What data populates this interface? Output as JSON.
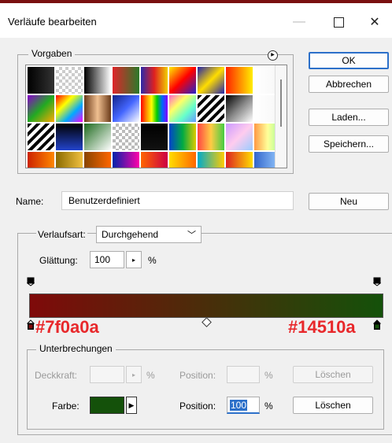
{
  "window": {
    "title": "Verläufe bearbeiten",
    "controls": {
      "minimize": "—",
      "close": "✕"
    }
  },
  "presets": {
    "label": "Vorgaben",
    "swatches": [
      "linear-gradient(90deg,#000,#333)",
      "repeating-conic-gradient(#ccc 0 25%,#fff 0 50%) 0 0/8px 8px",
      "linear-gradient(90deg,#000,#fff)",
      "linear-gradient(90deg,#e0252a,#2a7a2a)",
      "linear-gradient(90deg,#2a2aaa,#e02020,#f0d000)",
      "linear-gradient(135deg,#ffee00,#ff0000,#2222cc)",
      "linear-gradient(135deg,#2222aa,#ffdd00,#2222aa)",
      "linear-gradient(90deg,#ff2200,#ffee00)",
      "linear-gradient(90deg,#fff,#f6f6f6)",
      "linear-gradient(135deg,#8800cc,#22aa22,#ffaa00)",
      "linear-gradient(135deg,#ff0000,#ffff00,#00aaff,#ff00ff)",
      "linear-gradient(90deg,#6b3a1a,#f0c090,#6b3a1a)",
      "linear-gradient(135deg,#112288,#4466ff,#ffffff)",
      "linear-gradient(90deg,#ff0000,#ff8800,#ffff00,#00cc00,#0066ff,#8800ff)",
      "linear-gradient(135deg,#ff66cc,#ffff66,#66ffcc,#6699ff)",
      "repeating-linear-gradient(135deg,#000 0 4px,#fff 4px 8px)",
      "linear-gradient(135deg,#000,#888,#fff)",
      "linear-gradient(90deg,#fff,#f6f6f6)",
      "repeating-linear-gradient(135deg,#000 0 4px,#fff 4px 8px)",
      "linear-gradient(180deg,#000,#2244cc)",
      "linear-gradient(135deg,#1f6b1f,#ffffff)",
      "repeating-conic-gradient(#bbb 0 25%,#fff 0 50%) 0 0/8px 8px",
      "linear-gradient(180deg,#000,#111)",
      "linear-gradient(90deg,#0044cc,#00aa44,#ddcc00)",
      "linear-gradient(90deg,#ff4444,#ffcc44,#44cc44)",
      "linear-gradient(135deg,#cc99ff,#ffccee,#99ccff)",
      "linear-gradient(90deg,#ff9944,#ffff99,#99ff99)",
      "linear-gradient(90deg,#cc2200,#ff8800)",
      "linear-gradient(90deg,#8a6a00,#f0c040)",
      "linear-gradient(90deg,#884400,#ff6600)",
      "linear-gradient(90deg,#0022aa,#ff00aa)",
      "linear-gradient(90deg,#ff6600,#cc0044)",
      "linear-gradient(90deg,#ffdd00,#ff6600)",
      "linear-gradient(90deg,#00aacc,#ffcc00)",
      "linear-gradient(90deg,#dd2222,#ffdd00)",
      "linear-gradient(90deg,#3366cc,#99ccff)"
    ]
  },
  "buttons": {
    "ok": "OK",
    "cancel": "Abbrechen",
    "load": "Laden...",
    "save": "Speichern...",
    "new": "Neu"
  },
  "name": {
    "label": "Name:",
    "value": "Benutzerdefiniert"
  },
  "gradient": {
    "type_label": "Verlaufsart:",
    "type_value": "Durchgehend",
    "smoothness_label": "Glättung:",
    "smoothness_value": "100",
    "percent": "%",
    "start_color": "#7f0a0a",
    "end_color": "#14510a",
    "annotation_left": "#7f0a0a",
    "annotation_right": "#14510a"
  },
  "stops": {
    "group_label": "Unterbrechungen",
    "opacity_label": "Deckkraft:",
    "percent": "%",
    "position_label": "Position:",
    "delete_label": "Löschen",
    "color_label": "Farbe:",
    "color_value": "#14510a",
    "color_position_value": "100"
  }
}
